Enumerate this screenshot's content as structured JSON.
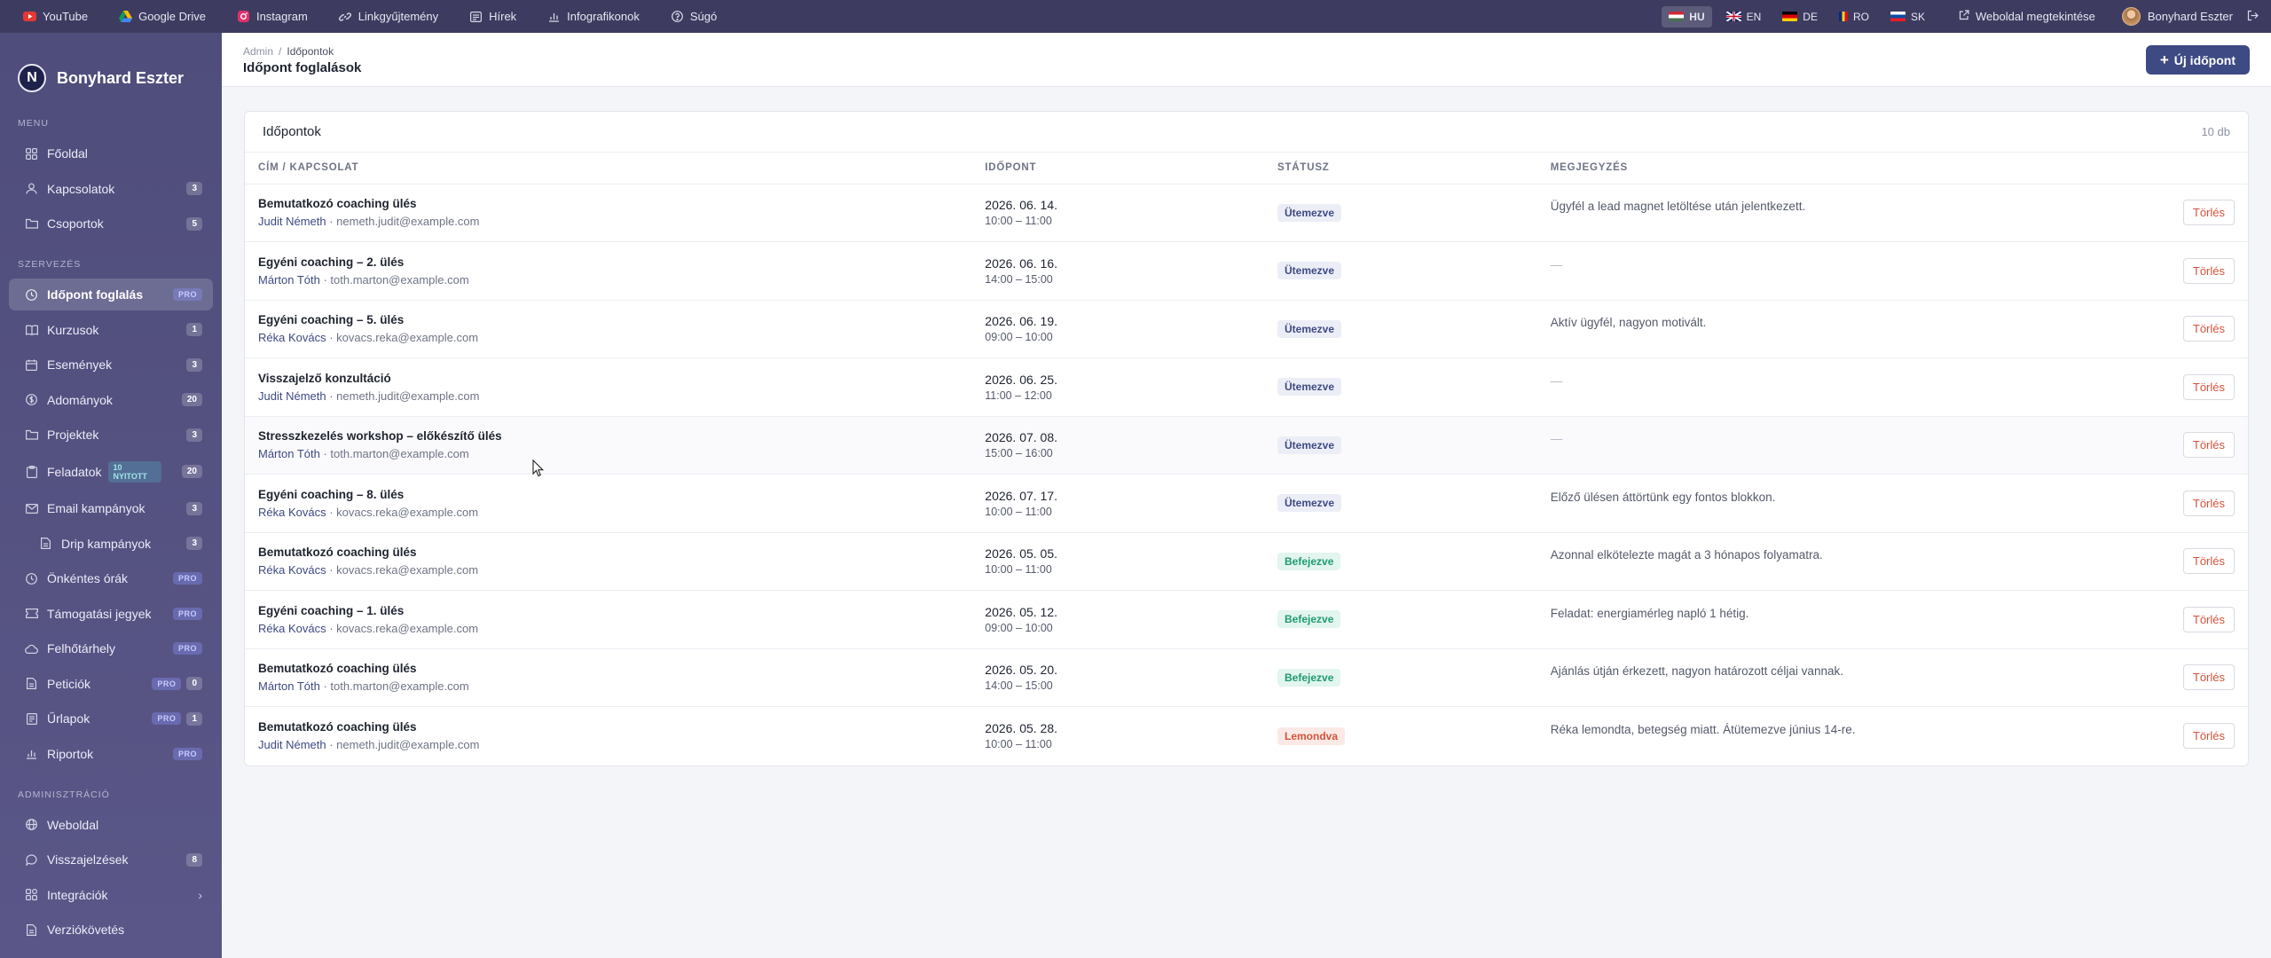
{
  "topbar": {
    "links": [
      {
        "label": "YouTube",
        "icon": "youtube-icon"
      },
      {
        "label": "Google Drive",
        "icon": "google-drive-icon"
      },
      {
        "label": "Instagram",
        "icon": "instagram-icon"
      },
      {
        "label": "Linkgyűjtemény",
        "icon": "link-icon"
      },
      {
        "label": "Hírek",
        "icon": "news-icon"
      },
      {
        "label": "Infografikonok",
        "icon": "chart-icon"
      },
      {
        "label": "Súgó",
        "icon": "help-icon"
      }
    ],
    "languages": [
      {
        "code": "HU",
        "active": true
      },
      {
        "code": "EN",
        "active": false
      },
      {
        "code": "DE",
        "active": false
      },
      {
        "code": "RO",
        "active": false
      },
      {
        "code": "SK",
        "active": false
      }
    ],
    "view_site": "Weboldal megtekintése",
    "user_name": "Bonyhard Eszter"
  },
  "sidebar": {
    "brand_initial": "N",
    "brand_name": "Bonyhard Eszter",
    "sections": {
      "menu": "MENU",
      "org": "SZERVEZÉS",
      "admin": "ADMINISZTRÁCIÓ"
    },
    "menu_items": [
      {
        "label": "Főoldal",
        "badge": ""
      },
      {
        "label": "Kapcsolatok",
        "badge": "3"
      },
      {
        "label": "Csoportok",
        "badge": "5"
      }
    ],
    "org_items": [
      {
        "label": "Időpont foglalás",
        "badge": "",
        "pro": "PRO",
        "active": true
      },
      {
        "label": "Kurzusok",
        "badge": "1"
      },
      {
        "label": "Események",
        "badge": "3"
      },
      {
        "label": "Adományok",
        "badge": "20"
      },
      {
        "label": "Projektek",
        "badge": "3"
      },
      {
        "label": "Feladatok",
        "badge": "20",
        "open": "10 NYITOTT"
      },
      {
        "label": "Email kampányok",
        "badge": "3"
      },
      {
        "label": "Drip kampányok",
        "badge": "3",
        "sub": true
      },
      {
        "label": "Önkéntes órák",
        "pro": "PRO"
      },
      {
        "label": "Támogatási jegyek",
        "pro": "PRO"
      },
      {
        "label": "Felhőtárhely",
        "pro": "PRO"
      },
      {
        "label": "Peticiók",
        "pro": "PRO",
        "badge": "0"
      },
      {
        "label": "Űrlapok",
        "pro": "PRO",
        "badge": "1"
      },
      {
        "label": "Riportok",
        "pro": "PRO"
      }
    ],
    "admin_items": [
      {
        "label": "Weboldal"
      },
      {
        "label": "Visszajelzések",
        "badge": "8"
      },
      {
        "label": "Integrációk",
        "chevron": true
      },
      {
        "label": "Verziókövetés"
      }
    ]
  },
  "header": {
    "breadcrumb_root": "Admin",
    "breadcrumb_sep": "/",
    "breadcrumb_current": "Időpontok",
    "title": "Időpont foglalások",
    "new_button": "Új időpont"
  },
  "card": {
    "title": "Időpontok",
    "count": "10 db",
    "columns": [
      "CÍM / KAPCSOLAT",
      "IDŐPONT",
      "STÁTUSZ",
      "MEGJEGYZÉS"
    ],
    "delete_label": "Törlés",
    "rows": [
      {
        "title": "Bemutatkozó coaching ülés",
        "name": "Judit Németh",
        "email": "nemeth.judit@example.com",
        "date": "2026. 06. 14.",
        "time": "10:00 – 11:00",
        "status": "Ütemezve",
        "status_type": "sched",
        "note": "Ügyfél a lead magnet letöltése után jelentkezett."
      },
      {
        "title": "Egyéni coaching – 2. ülés",
        "name": "Márton Tóth",
        "email": "toth.marton@example.com",
        "date": "2026. 06. 16.",
        "time": "14:00 – 15:00",
        "status": "Ütemezve",
        "status_type": "sched",
        "note": "—"
      },
      {
        "title": "Egyéni coaching – 5. ülés",
        "name": "Réka Kovács",
        "email": "kovacs.reka@example.com",
        "date": "2026. 06. 19.",
        "time": "09:00 – 10:00",
        "status": "Ütemezve",
        "status_type": "sched",
        "note": "Aktív ügyfél, nagyon motivált."
      },
      {
        "title": "Visszajelző konzultáció",
        "name": "Judit Németh",
        "email": "nemeth.judit@example.com",
        "date": "2026. 06. 25.",
        "time": "11:00 – 12:00",
        "status": "Ütemezve",
        "status_type": "sched",
        "note": "—"
      },
      {
        "title": "Stresszkezelés workshop – előkészítő ülés",
        "name": "Márton Tóth",
        "email": "toth.marton@example.com",
        "date": "2026. 07. 08.",
        "time": "15:00 – 16:00",
        "status": "Ütemezve",
        "status_type": "sched",
        "note": "—"
      },
      {
        "title": "Egyéni coaching – 8. ülés",
        "name": "Réka Kovács",
        "email": "kovacs.reka@example.com",
        "date": "2026. 07. 17.",
        "time": "10:00 – 11:00",
        "status": "Ütemezve",
        "status_type": "sched",
        "note": "Előző ülésen áttörtünk egy fontos blokkon."
      },
      {
        "title": "Bemutatkozó coaching ülés",
        "name": "Réka Kovács",
        "email": "kovacs.reka@example.com",
        "date": "2026. 05. 05.",
        "time": "10:00 – 11:00",
        "status": "Befejezve",
        "status_type": "done",
        "note": "Azonnal elkötelezte magát a 3 hónapos folyamatra."
      },
      {
        "title": "Egyéni coaching – 1. ülés",
        "name": "Réka Kovács",
        "email": "kovacs.reka@example.com",
        "date": "2026. 05. 12.",
        "time": "09:00 – 10:00",
        "status": "Befejezve",
        "status_type": "done",
        "note": "Feladat: energiamérleg napló 1 hétig."
      },
      {
        "title": "Bemutatkozó coaching ülés",
        "name": "Márton Tóth",
        "email": "toth.marton@example.com",
        "date": "2026. 05. 20.",
        "time": "14:00 – 15:00",
        "status": "Befejezve",
        "status_type": "done",
        "note": "Ajánlás útján érkezett, nagyon határozott céljai vannak."
      },
      {
        "title": "Bemutatkozó coaching ülés",
        "name": "Judit Németh",
        "email": "nemeth.judit@example.com",
        "date": "2026. 05. 28.",
        "time": "10:00 – 11:00",
        "status": "Lemondva",
        "status_type": "cancel",
        "note": "Réka lemondta, betegség miatt. Átütemezve június 14-re."
      }
    ]
  },
  "colors": {
    "topbar": "#3d3c60",
    "sidebar": "#4f4d7b",
    "accent": "#3e4a83",
    "scheduled": "#3e4a83",
    "done": "#1f9b70",
    "cancel": "#d4533b"
  }
}
